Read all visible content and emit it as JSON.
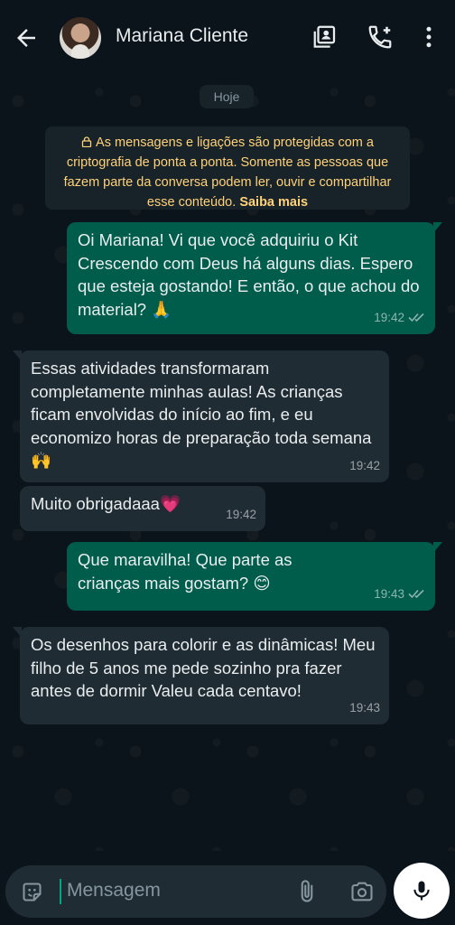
{
  "header": {
    "contact_name": "Mariana Cliente"
  },
  "chat": {
    "date_label": "Hoje",
    "encryption_text": "As mensagens e ligações são protegidas com a criptografia de ponta a ponta. Somente as pessoas que fazem parte da conversa podem ler, ouvir e compartilhar esse conteúdo.",
    "encryption_link": "Saiba mais",
    "messages": [
      {
        "direction": "out",
        "text": "Oi Mariana! Vi que você adquiriu o Kit Crescendo com Deus há alguns dias. Espero que esteja gostando! E então, o que achou do material? 🙏",
        "time": "19:42",
        "status": "read"
      },
      {
        "direction": "in",
        "text": "Essas atividades transformaram completamente minhas aulas! As crianças ficam envolvidas do início ao fim, e eu economizo horas de preparação toda semana 🙌",
        "time": "19:42"
      },
      {
        "direction": "in",
        "text": "Muito obrigadaaa💗",
        "time": "19:42"
      },
      {
        "direction": "out",
        "text": "Que maravilha! Que parte as crianças mais gostam? 😊",
        "time": "19:43",
        "status": "read"
      },
      {
        "direction": "in",
        "text": "Os desenhos para colorir e as dinâmicas! Meu filho de 5 anos me pede sozinho pra fazer antes de dormir Valeu cada centavo!",
        "time": "19:43"
      }
    ]
  },
  "composer": {
    "placeholder": "Mensagem"
  },
  "colors": {
    "background": "#0b141a",
    "outgoing_bubble": "#005c4b",
    "incoming_bubble": "#202c33",
    "accent": "#00a884",
    "encryption_text": "#ffd279"
  },
  "icons": [
    "back-arrow-icon",
    "contact-card-icon",
    "add-call-icon",
    "more-vert-icon",
    "lock-icon",
    "double-check-icon",
    "sticker-icon",
    "attach-icon",
    "camera-icon",
    "mic-icon"
  ]
}
